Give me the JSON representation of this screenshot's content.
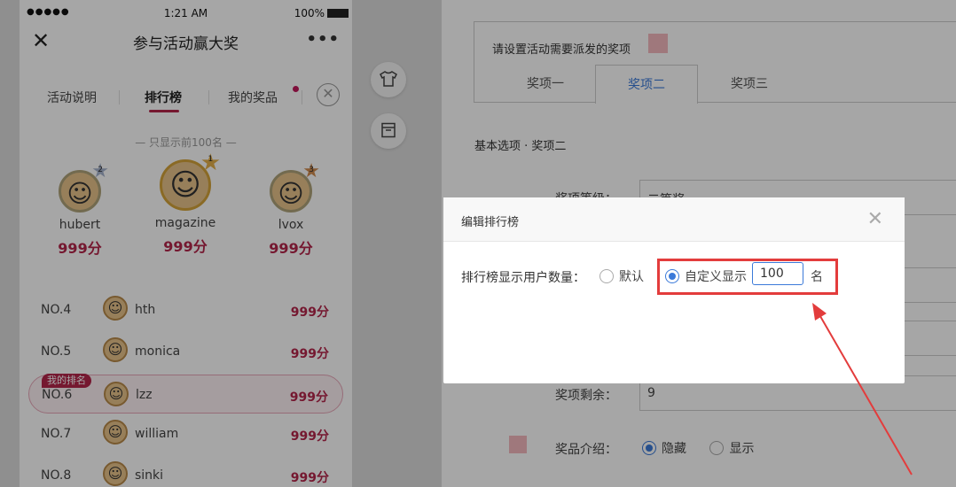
{
  "phone": {
    "status": {
      "signal": "●●●●●",
      "time": "1:21 AM",
      "battery": "100%"
    },
    "nav": {
      "close": "✕",
      "title": "参与活动赢大奖",
      "more": "•••"
    },
    "tabs": [
      {
        "label": "活动说明"
      },
      {
        "label": "排行榜"
      },
      {
        "label": "我的奖品"
      }
    ],
    "tab_close": "✕",
    "only_top_note": "— 只显示前100名 —",
    "podium": [
      {
        "rank": "2",
        "name": "hubert",
        "score": "999分"
      },
      {
        "rank": "1",
        "name": "magazine",
        "score": "999分"
      },
      {
        "rank": "3",
        "name": "lvox",
        "score": "999分"
      }
    ],
    "mine_badge": "我的排名",
    "ranking": [
      {
        "no": "NO.4",
        "name": "hth",
        "score": "999分"
      },
      {
        "no": "NO.5",
        "name": "monica",
        "score": "999分"
      },
      {
        "no": "NO.6",
        "name": "lzz",
        "score": "999分"
      },
      {
        "no": "NO.7",
        "name": "william",
        "score": "999分"
      },
      {
        "no": "NO.8",
        "name": "sinki",
        "score": "999分"
      }
    ]
  },
  "fab": {
    "shirt_icon": "shirt-icon",
    "box_icon": "box-icon"
  },
  "panel": {
    "set_title": "请设置活动需要派发的奖项",
    "prize_tabs": [
      "奖项一",
      "奖项二",
      "奖项三"
    ],
    "section_title": "基本选项 · 奖项二",
    "level_label": "奖项等级：",
    "level_value": "二等奖",
    "remain_label": "奖项剩余：",
    "remain_value": "9",
    "intro_label": "奖品介绍：",
    "intro_options": [
      "隐藏",
      "显示"
    ]
  },
  "dialog": {
    "title": "编辑排行榜",
    "close": "✕",
    "label": "排行榜显示用户数量：",
    "option_default": "默认",
    "option_custom": "自定义显示",
    "count_value": "100",
    "unit": "名"
  },
  "colors": {
    "accent": "#b4254b",
    "link": "#3b7ad9",
    "highlight": "#e33c3c"
  }
}
